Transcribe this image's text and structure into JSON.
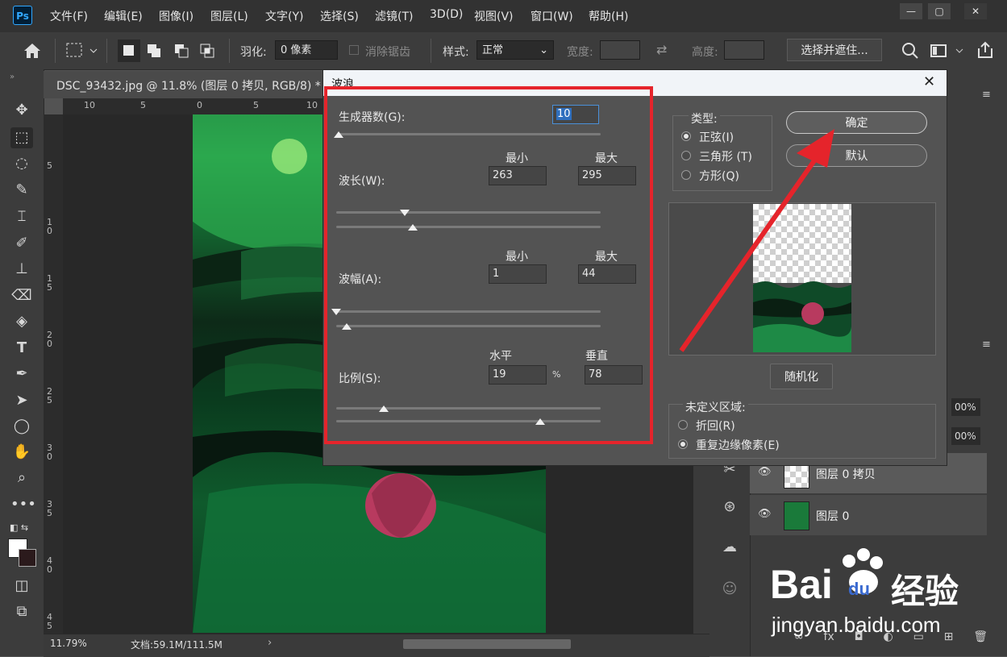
{
  "app": {
    "logo": "Ps"
  },
  "menu": [
    "文件(F)",
    "编辑(E)",
    "图像(I)",
    "图层(L)",
    "文字(Y)",
    "选择(S)",
    "滤镜(T)",
    "3D(D)",
    "视图(V)",
    "窗口(W)",
    "帮助(H)"
  ],
  "window_controls": {
    "minimize": "—",
    "restore": "▢",
    "close": "✕"
  },
  "options": {
    "feather_label": "羽化:",
    "feather_value": "0 像素",
    "antialias_label": "消除锯齿",
    "style_label": "样式:",
    "style_value": "正常",
    "width_label": "宽度:",
    "height_label": "高度:",
    "select_mask_button": "选择并遮住..."
  },
  "document": {
    "tab_title": "DSC_93432.jpg @ 11.8% (图层 0 拷贝, RGB/8) *",
    "ruler_top": [
      "10",
      "5",
      "0",
      "5",
      "10"
    ],
    "ruler_left": [
      "5",
      "1\n0",
      "1\n5",
      "2\n0",
      "2\n5",
      "3\n0",
      "3\n5",
      "4\n0",
      "4\n5"
    ],
    "zoom": "11.79%",
    "doc_info": "文档:59.1M/111.5M",
    "arrow": "›"
  },
  "dialog": {
    "title": "波浪",
    "close": "✕",
    "generators_label": "生成器数(G):",
    "generators_value": "10",
    "min_label": "最小",
    "max_label": "最大",
    "wavelength_label": "波长(W):",
    "wavelength_min": "263",
    "wavelength_max": "295",
    "amplitude_label": "波幅(A):",
    "amplitude_min": "1",
    "amplitude_max": "44",
    "horizontal_label": "水平",
    "vertical_label": "垂直",
    "scale_label": "比例(S):",
    "scale_h": "19",
    "scale_v": "78",
    "percent": "%",
    "type_label": "类型:",
    "type_sine": "正弦(I)",
    "type_triangle": "三角形 (T)",
    "type_square": "方形(Q)",
    "ok_button": "确定",
    "default_button": "默认",
    "randomize_button": "随机化",
    "undefined_label": "未定义区域:",
    "wrap_around": "折回(R)",
    "repeat_edge": "重复边缘像素(E)"
  },
  "sliders": {
    "generators": 0.0,
    "wavelength_min": 0.26,
    "wavelength_max": 0.29,
    "amplitude_min": 0.0,
    "amplitude_max": 0.04,
    "scale_h": 0.18,
    "scale_v": 0.77
  },
  "layers": {
    "opacity": "00%",
    "fill": "00%",
    "items": [
      {
        "name": "图层 0 拷贝"
      },
      {
        "name": "图层 0"
      }
    ],
    "footer_icons": [
      "∞",
      "fx",
      "◘",
      "◐",
      "▭",
      "⊞",
      "🗑"
    ]
  },
  "watermark": {
    "brand": "Bai",
    "brand2": "du",
    "brand_cn": "经验",
    "url": "jingyan.baidu.com"
  },
  "colors": {
    "highlight": "#e5242b",
    "ps_blue": "#31a8ff"
  }
}
